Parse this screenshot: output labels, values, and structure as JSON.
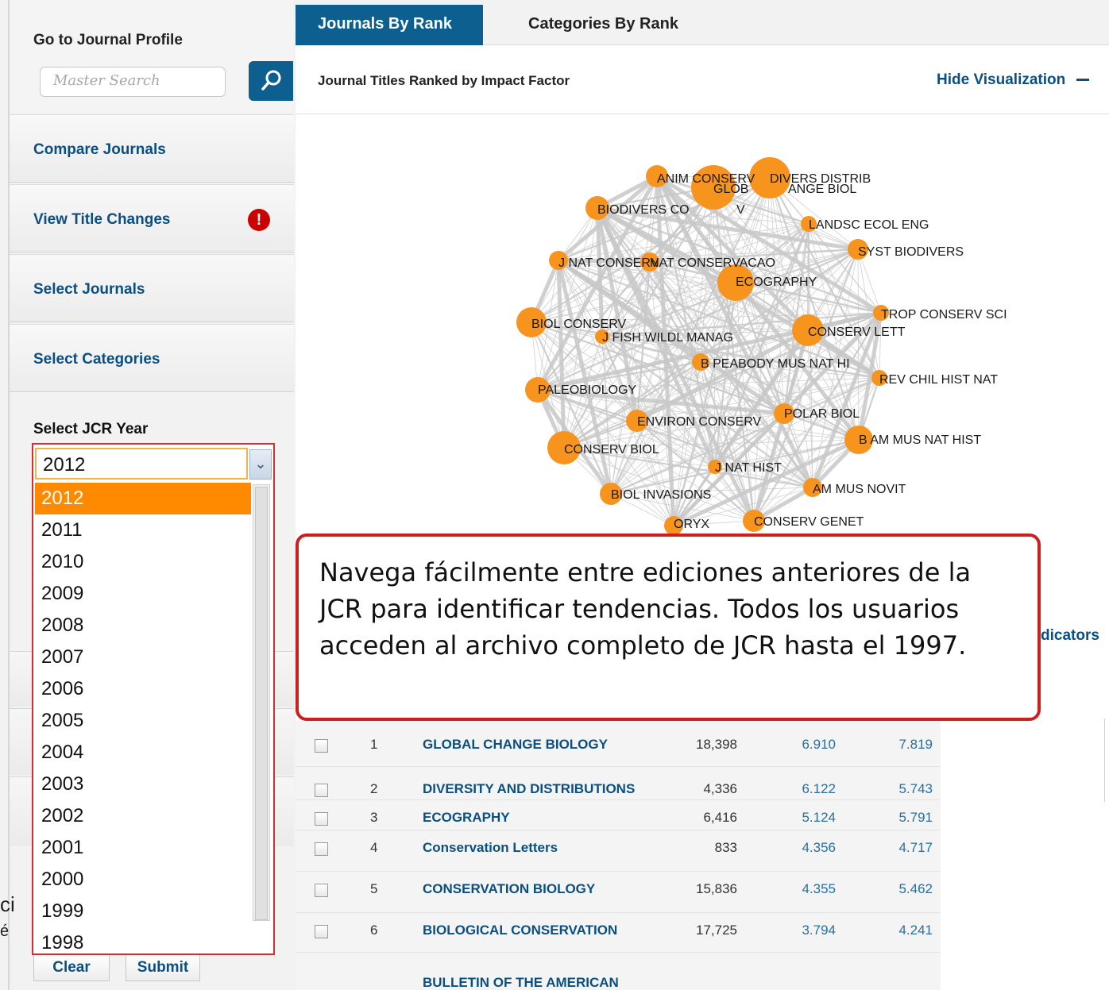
{
  "sidebar": {
    "title": "Go to Journal Profile",
    "search_placeholder": "Master Search",
    "items": [
      {
        "label": "Compare Journals"
      },
      {
        "label": "View Title Changes"
      },
      {
        "label": "Select Journals"
      },
      {
        "label": "Select Categories"
      }
    ],
    "year_label": "Select JCR Year",
    "partial_texts": [
      "ci",
      "é"
    ],
    "clear_label": "Clear",
    "submit_label": "Submit"
  },
  "year_dropdown": {
    "selected": "2012",
    "options": [
      "2012",
      "2011",
      "2010",
      "2009",
      "2008",
      "2007",
      "2006",
      "2005",
      "2004",
      "2003",
      "2002",
      "2001",
      "2000",
      "1999",
      "1998"
    ]
  },
  "tabs": [
    {
      "label": "Journals By Rank",
      "active": true
    },
    {
      "label": "Categories By Rank",
      "active": false
    }
  ],
  "main": {
    "subheading": "Journal Titles Ranked by Impact Factor",
    "hide_viz": "Hide Visualization"
  },
  "network": {
    "nodes": [
      {
        "label": "ANIM CONSERV"
      },
      {
        "label": "GLOB"
      },
      {
        "label": "ANGE BIOL"
      },
      {
        "label": "DIVERS DISTRIB"
      },
      {
        "label": "BIODIVERS CO"
      },
      {
        "label": "V"
      },
      {
        "label": "LANDSC ECOL ENG"
      },
      {
        "label": "SYST BIODIVERS"
      },
      {
        "label": "J NAT CONSERV"
      },
      {
        "label": "NAT CONSERVACAO"
      },
      {
        "label": "ECOGRAPHY"
      },
      {
        "label": "TROP CONSERV SCI"
      },
      {
        "label": "BIOL CONSERV"
      },
      {
        "label": "J FISH WILDL MANAG"
      },
      {
        "label": "CONSERV LETT"
      },
      {
        "label": "B PEABODY MUS NAT HI"
      },
      {
        "label": "REV CHIL HIST NAT"
      },
      {
        "label": "PALEOBIOLOGY"
      },
      {
        "label": "POLAR BIOL"
      },
      {
        "label": "ENVIRON CONSERV"
      },
      {
        "label": "B AM MUS NAT HIST"
      },
      {
        "label": "CONSERV BIOL"
      },
      {
        "label": "J NAT HIST"
      },
      {
        "label": "AM MUS NOVIT"
      },
      {
        "label": "BIOL INVASIONS"
      },
      {
        "label": "CONSERV GENET"
      },
      {
        "label": "ORYX"
      }
    ],
    "node_color": "#f7941d",
    "edge_color": "#c8c8c8"
  },
  "callout": {
    "text": "Navega fácilmente entre ediciones anteriores de la JCR para identificar tendencias. Todos los usuarios acceden al archivo completo de JCR hasta el 1997."
  },
  "indicators_label": "dicators",
  "table": {
    "rows": [
      {
        "rank": "1",
        "title": "GLOBAL CHANGE BIOLOGY",
        "cites": "18,398",
        "jif": "6.910",
        "jif5": "7.819"
      },
      {
        "rank": "2",
        "title": "DIVERSITY AND DISTRIBUTIONS",
        "cites": "4,336",
        "jif": "6.122",
        "jif5": "5.743"
      },
      {
        "rank": "3",
        "title": "ECOGRAPHY",
        "cites": "6,416",
        "jif": "5.124",
        "jif5": "5.791"
      },
      {
        "rank": "4",
        "title": "Conservation Letters",
        "cites": "833",
        "jif": "4.356",
        "jif5": "4.717"
      },
      {
        "rank": "5",
        "title": "CONSERVATION BIOLOGY",
        "cites": "15,836",
        "jif": "4.355",
        "jif5": "5.462"
      },
      {
        "rank": "6",
        "title": "BIOLOGICAL CONSERVATION",
        "cites": "17,725",
        "jif": "3.794",
        "jif5": "4.241"
      },
      {
        "rank": "",
        "title": "BULLETIN OF THE AMERICAN",
        "cites": "",
        "jif": "",
        "jif5": ""
      }
    ]
  }
}
